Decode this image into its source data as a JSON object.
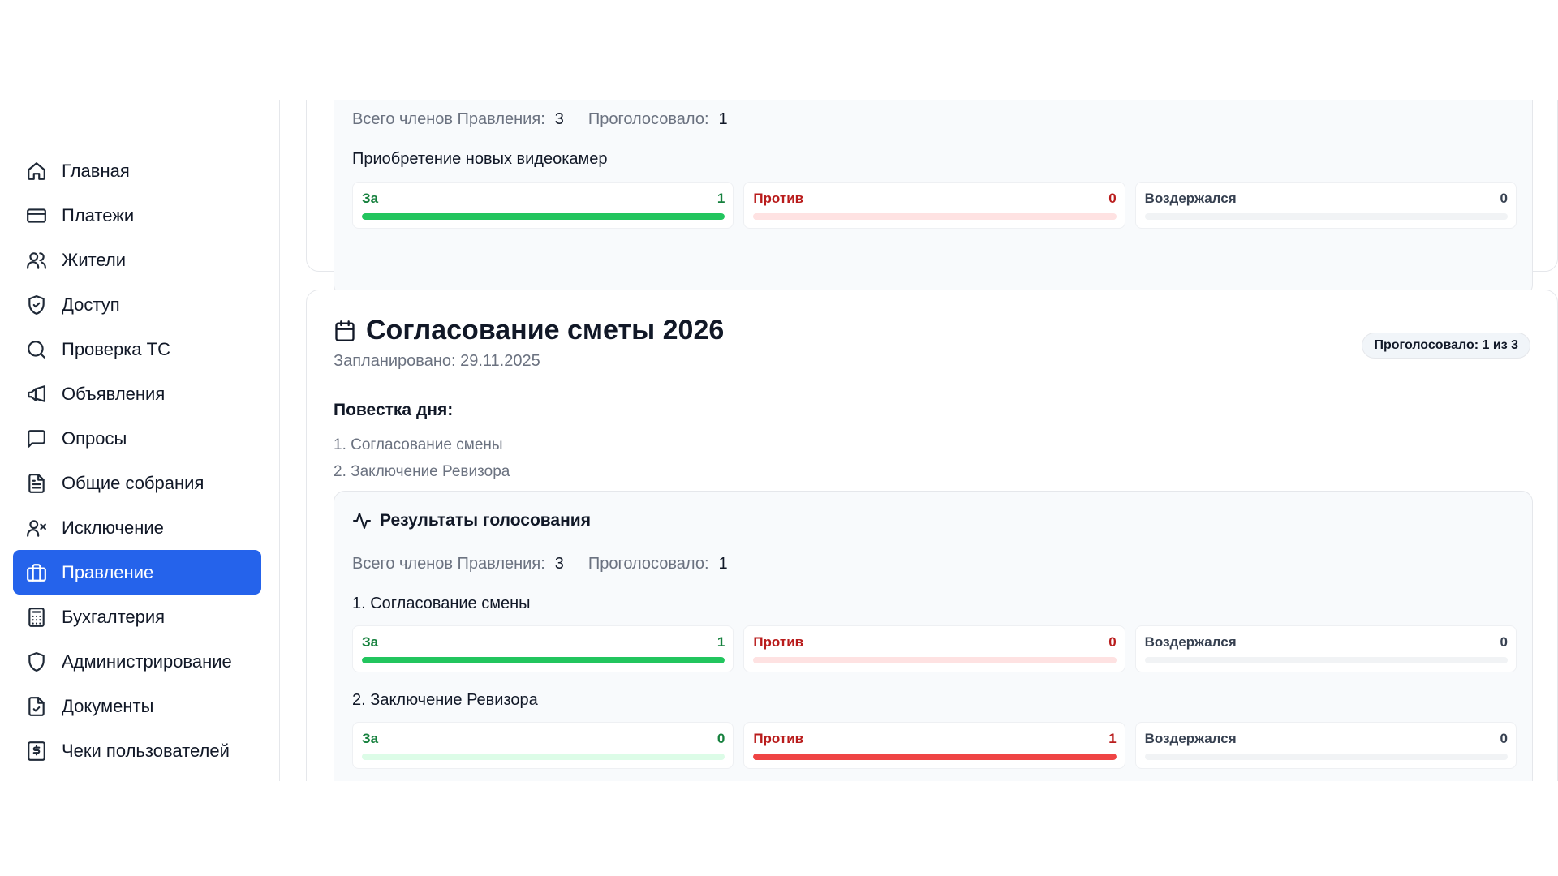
{
  "sidebar": {
    "items": [
      {
        "label": "Главная",
        "icon": "home-icon"
      },
      {
        "label": "Платежи",
        "icon": "credit-card-icon"
      },
      {
        "label": "Жители",
        "icon": "users-icon"
      },
      {
        "label": "Доступ",
        "icon": "shield-check-icon"
      },
      {
        "label": "Проверка ТС",
        "icon": "search-icon"
      },
      {
        "label": "Объявления",
        "icon": "megaphone-icon"
      },
      {
        "label": "Опросы",
        "icon": "message-square-icon"
      },
      {
        "label": "Общие собрания",
        "icon": "file-text-icon"
      },
      {
        "label": "Исключение",
        "icon": "user-x-icon"
      },
      {
        "label": "Правление",
        "icon": "briefcase-icon",
        "active": true
      },
      {
        "label": "Бухгалтерия",
        "icon": "calculator-icon"
      },
      {
        "label": "Администрирование",
        "icon": "shield-icon"
      },
      {
        "label": "Документы",
        "icon": "file-check-icon"
      },
      {
        "label": "Чеки пользователей",
        "icon": "receipt-icon"
      }
    ],
    "active_color": "#2563eb"
  },
  "card1": {
    "stats": {
      "total_label": "Всего членов Правления:",
      "total_value": "3",
      "voted_label": "Проголосовало:",
      "voted_value": "1"
    },
    "question": "Приобретение новых видеокамер",
    "votes": {
      "for_label": "За",
      "for_count": "1",
      "for_share": 1,
      "against_label": "Против",
      "against_count": "0",
      "against_share": 0,
      "abstain_label": "Воздержался",
      "abstain_count": "0",
      "abstain_share": 0
    }
  },
  "card2": {
    "title": "Согласование сметы 2026",
    "scheduled": "Запланировано: 29.11.2025",
    "badge": "Проголосовало: 1 из 3",
    "agenda_title": "Повестка дня:",
    "agenda": [
      "1. Согласование смены",
      "2. Заключение Ревизора"
    ],
    "results_title": "Результаты голосования",
    "stats": {
      "total_label": "Всего членов Правления:",
      "total_value": "3",
      "voted_label": "Проголосовало:",
      "voted_value": "1"
    },
    "questions": [
      {
        "title": "1. Согласование смены",
        "for_label": "За",
        "for_count": "1",
        "for_share": 1,
        "against_label": "Против",
        "against_count": "0",
        "against_share": 0,
        "abstain_label": "Воздержался",
        "abstain_count": "0",
        "abstain_share": 0
      },
      {
        "title": "2. Заключение Ревизора",
        "for_label": "За",
        "for_count": "0",
        "for_share": 0,
        "against_label": "Против",
        "against_count": "1",
        "against_share": 1,
        "abstain_label": "Воздержался",
        "abstain_count": "0",
        "abstain_share": 0
      }
    ]
  },
  "colors": {
    "for": "#22c55e",
    "against": "#ef4444",
    "accent": "#2563eb"
  }
}
